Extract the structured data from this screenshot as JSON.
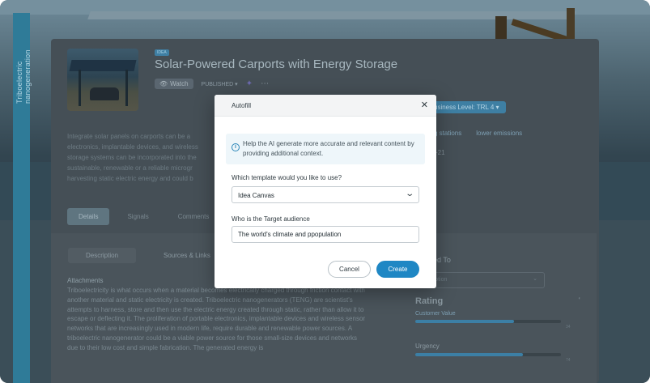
{
  "sidebar": {
    "vertical_label": "Triboelectric nanogeneration"
  },
  "idea": {
    "tag_chip": "IDEA",
    "tag_text": "",
    "title": "Solar-Powered Carports with Energy Storage",
    "watch_label": "Watch",
    "status_label": "PUBLISHED",
    "more_icon": "more-dots-icon",
    "readiness_label": "usiness Level: TRL 4",
    "link_1": "g stations",
    "link_2": "lower emissions",
    "meta_count": "+21",
    "description_bg": "Integrate solar panels on carports can be a electronics, implantable devices, and wireless storage systems can be incorporated into the sustainable, renewable or a reliable microgr harvesting static electric energy and could b"
  },
  "tabs": [
    {
      "label": "Details",
      "active": true
    },
    {
      "label": "Signals",
      "active": false
    },
    {
      "label": "Comments",
      "active": false
    }
  ],
  "subtabs": [
    {
      "label": "Description"
    },
    {
      "label": "Sources & Links"
    }
  ],
  "content": {
    "attachments_label": "Attachments",
    "body": "Triboelectricity is what occurs when a material becomes electrically charged through friction contact with another material and static electricity is created. Triboelectric nanogenerators (TENG) are scientist's attempts to harness, store and then use the electric energy created through static, rather than allow it to escape or deflecting it. The proliferation of portable electronics, implantable devices and wireless sensor networks that are increasingly used in modern life, require durable and renewable power sources. A triboelectric nanogenerator could be a viable power source for those small-size devices and networks due to their low cost and simple fabrication. The generated energy is"
  },
  "side_panel": {
    "connected_label": "nnected To",
    "select_placeholder": "an Option",
    "rating_label": "Rating",
    "customer_value_label": "Customer Value",
    "customer_value_fill": 0.68,
    "urgency_label": "Urgency",
    "urgency_fill": 0.74,
    "score_1": "34",
    "score_2": "74"
  },
  "modal": {
    "title": "Autofill",
    "close_icon": "close-icon",
    "info_text": "Help the AI generate more accurate and relevant content by providing additional context.",
    "template_label": "Which template would you like to use?",
    "template_value": "Idea Canvas",
    "audience_label": "Who is the Target audience",
    "audience_value": "The world's climate and ppopulation",
    "cancel_label": "Cancel",
    "create_label": "Create",
    "accent_color": "#1f87c4"
  }
}
